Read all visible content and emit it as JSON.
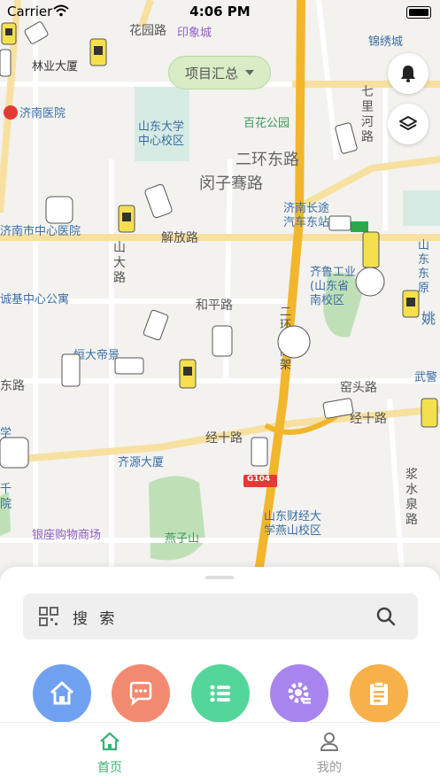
{
  "status_bar": {
    "carrier": "Carrier",
    "time": "4:06 PM"
  },
  "map": {
    "roads": [
      "花园路",
      "二环东路",
      "闵子骞路",
      "解放路",
      "和平路",
      "经十路",
      "窑头路",
      "东路",
      "二环东高架",
      "七里河路",
      "山大路",
      "浆水泉路"
    ],
    "road_labels": {
      "huayuan": "花园路",
      "erhuan_east": "二环东路",
      "minziqian": "闵子骞路",
      "jiefang": "解放路",
      "heping": "和平路",
      "jingshi": "经十路",
      "jingshi_right": "经十路",
      "yaotou": "窑头路",
      "dong": "东路",
      "gaojia": "二环东高架",
      "qilihe": "七里河路",
      "shanda": "山大路",
      "jiangshuiquan": "浆水泉路",
      "g104": "G104"
    },
    "pois": {
      "yinxiangcheng": "印象城",
      "linye": "林业大厦",
      "jinan_hospital": "济南医院",
      "shandong_univ": "山东大学\n中心校区",
      "baihua": "百花公园",
      "jinan_city_hospital": "济南市中心医院",
      "changtu": "济南长途\n汽车东站",
      "qilu": "齐鲁工业\n(山东省\n南校区",
      "chengji": "诚基中心公寓",
      "hengda": "恒大帝景",
      "qiyuan": "齐源大厦",
      "yanzishan": "燕子山",
      "yinzuo": "银座购物商场",
      "caijing": "山东财经大\n学燕山校区",
      "jinxiu": "锦绣城",
      "shandong_r": "山东\n东原",
      "wujing": "武警",
      "yao": "姚",
      "qian": "千\n院",
      "xue": "学"
    }
  },
  "project_button": {
    "label": "项目汇总"
  },
  "map_controls": {
    "alarm": "bell-icon",
    "layers": "layers-icon"
  },
  "search": {
    "placeholder": "搜 索"
  },
  "quick_actions": [
    {
      "name": "home",
      "icon": "home-icon",
      "color": "#6fa1f0"
    },
    {
      "name": "message",
      "icon": "chat-icon",
      "color": "#f28a72"
    },
    {
      "name": "list",
      "icon": "list-icon",
      "color": "#54d69a"
    },
    {
      "name": "settings",
      "icon": "gear-icon",
      "color": "#a884ee"
    },
    {
      "name": "report",
      "icon": "clipboard-icon",
      "color": "#f7b04a"
    }
  ],
  "tabs": [
    {
      "label": "首页",
      "icon": "home-tab-icon",
      "active": true
    },
    {
      "label": "我的",
      "icon": "user-icon",
      "active": false
    }
  ],
  "colors": {
    "accent": "#3bb273",
    "inactive": "#999999"
  }
}
